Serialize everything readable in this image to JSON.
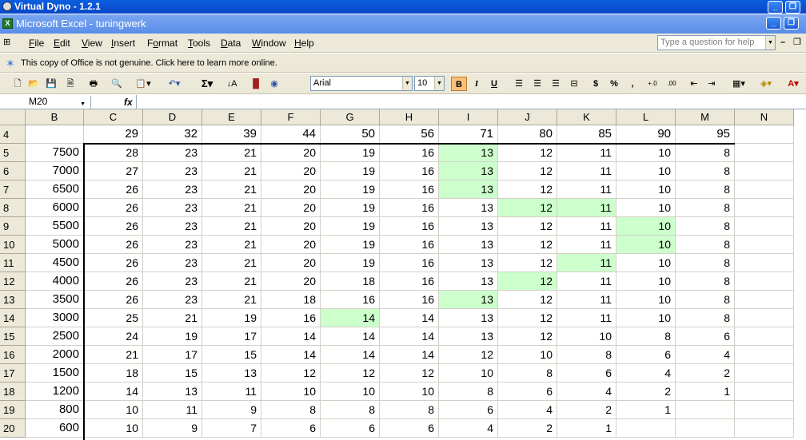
{
  "outer_window": {
    "title": "Virtual Dyno - 1.2.1"
  },
  "inner_window": {
    "title": "Microsoft Excel - tuningwerk",
    "icon": "excel-icon"
  },
  "menu": {
    "items": [
      {
        "label": "File",
        "key": "F",
        "rest": "ile"
      },
      {
        "label": "Edit",
        "key": "E",
        "rest": "dit"
      },
      {
        "label": "View",
        "key": "V",
        "rest": "iew"
      },
      {
        "label": "Insert",
        "key": "I",
        "rest": "nsert"
      },
      {
        "label": "Format",
        "key": "o",
        "pre": "F",
        "rest": "rmat"
      },
      {
        "label": "Tools",
        "key": "T",
        "rest": "ools"
      },
      {
        "label": "Data",
        "key": "D",
        "rest": "ata"
      },
      {
        "label": "Window",
        "key": "W",
        "rest": "indow"
      },
      {
        "label": "Help",
        "key": "H",
        "rest": "elp"
      }
    ],
    "help_placeholder": "Type a question for help"
  },
  "notice": {
    "text": "This copy of Office is not genuine.  Click here to learn more online."
  },
  "toolbar": {
    "font": "Arial",
    "size": "10",
    "bold": "B",
    "italic": "I",
    "underline": "U",
    "sum": "Σ",
    "currency": "$",
    "percent": "%",
    "comma": ","
  },
  "formula_bar": {
    "name_box": "M20",
    "fx": "fx"
  },
  "sheet": {
    "col_headers": [
      "B",
      "C",
      "D",
      "E",
      "F",
      "G",
      "H",
      "I",
      "J",
      "K",
      "L",
      "M",
      "N"
    ],
    "header_row": {
      "row": "4",
      "values": [
        "",
        "29",
        "32",
        "39",
        "44",
        "50",
        "56",
        "71",
        "80",
        "85",
        "90",
        "95"
      ]
    },
    "rows": [
      {
        "row": "5",
        "rpm": "7500",
        "values": [
          "28",
          "23",
          "21",
          "20",
          "19",
          "16",
          "13",
          "12",
          "11",
          "10",
          "8"
        ]
      },
      {
        "row": "6",
        "rpm": "7000",
        "values": [
          "27",
          "23",
          "21",
          "20",
          "19",
          "16",
          "13",
          "12",
          "11",
          "10",
          "8"
        ]
      },
      {
        "row": "7",
        "rpm": "6500",
        "values": [
          "26",
          "23",
          "21",
          "20",
          "19",
          "16",
          "13",
          "12",
          "11",
          "10",
          "8"
        ]
      },
      {
        "row": "8",
        "rpm": "6000",
        "values": [
          "26",
          "23",
          "21",
          "20",
          "19",
          "16",
          "13",
          "12",
          "11",
          "10",
          "8"
        ]
      },
      {
        "row": "9",
        "rpm": "5500",
        "values": [
          "26",
          "23",
          "21",
          "20",
          "19",
          "16",
          "13",
          "12",
          "11",
          "10",
          "8"
        ]
      },
      {
        "row": "10",
        "rpm": "5000",
        "values": [
          "26",
          "23",
          "21",
          "20",
          "19",
          "16",
          "13",
          "12",
          "11",
          "10",
          "8"
        ]
      },
      {
        "row": "11",
        "rpm": "4500",
        "values": [
          "26",
          "23",
          "21",
          "20",
          "19",
          "16",
          "13",
          "12",
          "11",
          "10",
          "8"
        ]
      },
      {
        "row": "12",
        "rpm": "4000",
        "values": [
          "26",
          "23",
          "21",
          "20",
          "18",
          "16",
          "13",
          "12",
          "11",
          "10",
          "8"
        ]
      },
      {
        "row": "13",
        "rpm": "3500",
        "values": [
          "26",
          "23",
          "21",
          "18",
          "16",
          "16",
          "13",
          "12",
          "11",
          "10",
          "8"
        ]
      },
      {
        "row": "14",
        "rpm": "3000",
        "values": [
          "25",
          "21",
          "19",
          "16",
          "14",
          "14",
          "13",
          "12",
          "11",
          "10",
          "8"
        ]
      },
      {
        "row": "15",
        "rpm": "2500",
        "values": [
          "24",
          "19",
          "17",
          "14",
          "14",
          "14",
          "13",
          "12",
          "10",
          "8",
          "6"
        ]
      },
      {
        "row": "16",
        "rpm": "2000",
        "values": [
          "21",
          "17",
          "15",
          "14",
          "14",
          "14",
          "12",
          "10",
          "8",
          "6",
          "4"
        ]
      },
      {
        "row": "17",
        "rpm": "1500",
        "values": [
          "18",
          "15",
          "13",
          "12",
          "12",
          "12",
          "10",
          "8",
          "6",
          "4",
          "2"
        ]
      },
      {
        "row": "18",
        "rpm": "1200",
        "values": [
          "14",
          "13",
          "11",
          "10",
          "10",
          "10",
          "8",
          "6",
          "4",
          "2",
          "1"
        ]
      },
      {
        "row": "19",
        "rpm": "800",
        "values": [
          "10",
          "11",
          "9",
          "8",
          "8",
          "8",
          "6",
          "4",
          "2",
          "1",
          ""
        ]
      },
      {
        "row": "20",
        "rpm": "600",
        "values": [
          "10",
          "9",
          "7",
          "6",
          "6",
          "6",
          "4",
          "2",
          "1",
          "",
          ""
        ]
      }
    ],
    "highlight_color": "#ccffcc",
    "highlighted_cells": [
      [
        0,
        6
      ],
      [
        1,
        6
      ],
      [
        2,
        6
      ],
      [
        3,
        7
      ],
      [
        3,
        8
      ],
      [
        4,
        9
      ],
      [
        5,
        9
      ],
      [
        6,
        8
      ],
      [
        7,
        7
      ],
      [
        8,
        6
      ],
      [
        9,
        4
      ]
    ]
  }
}
